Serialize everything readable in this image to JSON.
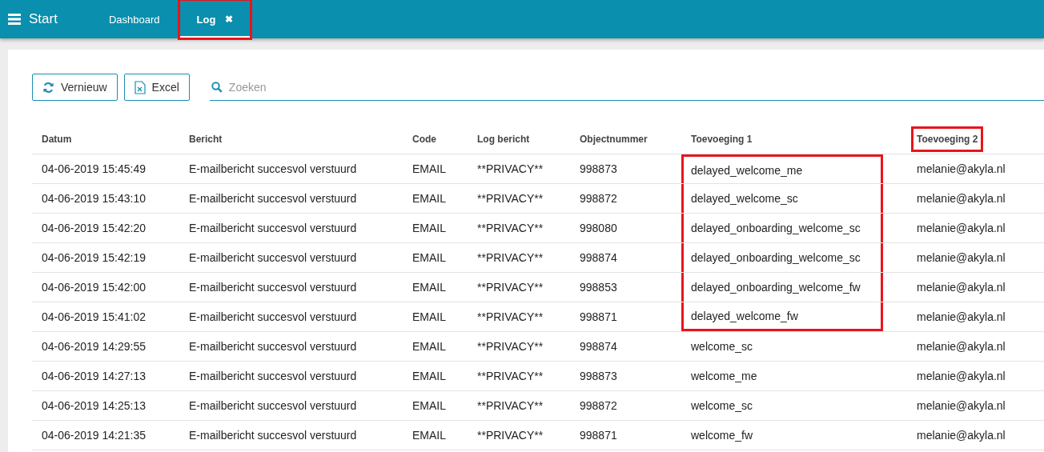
{
  "app_bar": {
    "title": "Start",
    "tabs": [
      {
        "label": "Dashboard",
        "selected": false,
        "closable": false,
        "marked": false
      },
      {
        "label": "Log",
        "selected": true,
        "closable": true,
        "close": "✖",
        "marked": true
      }
    ]
  },
  "toolbar": {
    "buttons": [
      {
        "label": "Vernieuw",
        "kind": "refresh"
      },
      {
        "label": "Excel",
        "kind": "excel"
      }
    ],
    "search": {
      "placeholder": "Zoeken"
    }
  },
  "table": {
    "columns": [
      {
        "label": "Datum",
        "marked": false
      },
      {
        "label": "Bericht",
        "marked": false
      },
      {
        "label": "Code",
        "marked": false
      },
      {
        "label": "Log bericht",
        "marked": false
      },
      {
        "label": "Objectnummer",
        "marked": false
      },
      {
        "label": "Toevoeging 1",
        "marked": false
      },
      {
        "label": "Toevoeging 2",
        "marked": true
      }
    ],
    "rows": [
      {
        "cells": [
          "04-06-2019 15:45:49",
          "E-mailbericht succesvol verstuurd",
          "EMAIL",
          "**PRIVACY**",
          "998873",
          "delayed_welcome_me",
          "melanie@akyla.nl"
        ],
        "toevoeging_1_marked": true
      },
      {
        "cells": [
          "04-06-2019 15:43:10",
          "E-mailbericht succesvol verstuurd",
          "EMAIL",
          "**PRIVACY**",
          "998872",
          "delayed_welcome_sc",
          "melanie@akyla.nl"
        ],
        "toevoeging_1_marked": true
      },
      {
        "cells": [
          "04-06-2019 15:42:20",
          "E-mailbericht succesvol verstuurd",
          "EMAIL",
          "**PRIVACY**",
          "998080",
          "delayed_onboarding_welcome_sc",
          "melanie@akyla.nl"
        ],
        "toevoeging_1_marked": true
      },
      {
        "cells": [
          "04-06-2019 15:42:19",
          "E-mailbericht succesvol verstuurd",
          "EMAIL",
          "**PRIVACY**",
          "998874",
          "delayed_onboarding_welcome_sc",
          "melanie@akyla.nl"
        ],
        "toevoeging_1_marked": true
      },
      {
        "cells": [
          "04-06-2019 15:42:00",
          "E-mailbericht succesvol verstuurd",
          "EMAIL",
          "**PRIVACY**",
          "998853",
          "delayed_onboarding_welcome_fw",
          "melanie@akyla.nl"
        ],
        "toevoeging_1_marked": true
      },
      {
        "cells": [
          "04-06-2019 15:41:02",
          "E-mailbericht succesvol verstuurd",
          "EMAIL",
          "**PRIVACY**",
          "998871",
          "delayed_welcome_fw",
          "melanie@akyla.nl"
        ],
        "toevoeging_1_marked": true
      },
      {
        "cells": [
          "04-06-2019 14:29:55",
          "E-mailbericht succesvol verstuurd",
          "EMAIL",
          "**PRIVACY**",
          "998874",
          "welcome_sc",
          "melanie@akyla.nl"
        ],
        "toevoeging_1_marked": false
      },
      {
        "cells": [
          "04-06-2019 14:27:13",
          "E-mailbericht succesvol verstuurd",
          "EMAIL",
          "**PRIVACY**",
          "998873",
          "welcome_me",
          "melanie@akyla.nl"
        ],
        "toevoeging_1_marked": false
      },
      {
        "cells": [
          "04-06-2019 14:25:13",
          "E-mailbericht succesvol verstuurd",
          "EMAIL",
          "**PRIVACY**",
          "998872",
          "welcome_sc",
          "melanie@akyla.nl"
        ],
        "toevoeging_1_marked": false
      },
      {
        "cells": [
          "04-06-2019 14:21:35",
          "E-mailbericht succesvol verstuurd",
          "EMAIL",
          "**PRIVACY**",
          "998871",
          "welcome_fw",
          "melanie@akyla.nl"
        ],
        "toevoeging_1_marked": false
      }
    ]
  }
}
